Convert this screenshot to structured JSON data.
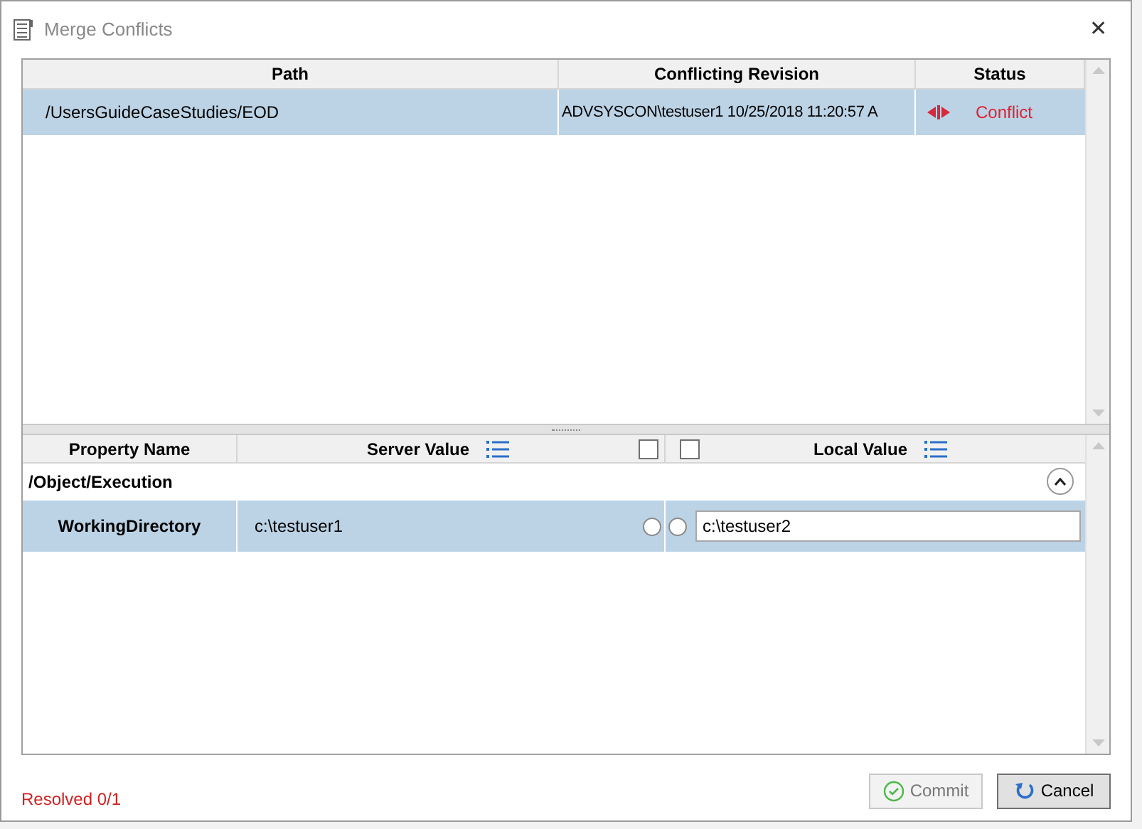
{
  "window": {
    "title": "Merge Conflicts",
    "close": "✕"
  },
  "conflicts": {
    "columns": [
      "Path",
      "Conflicting Revision",
      "Status"
    ],
    "rows": [
      {
        "path": "/UsersGuideCaseStudies/EOD",
        "revision": "ADVSYSCON\\testuser1 10/25/2018 11:20:57 A",
        "status": "Conflict",
        "selected": true
      }
    ]
  },
  "properties": {
    "columns": [
      "Property Name",
      "Server Value",
      "Local Value"
    ],
    "server_all_checked": false,
    "local_all_checked": false,
    "groups": [
      {
        "name": "/Object/Execution",
        "expanded": true,
        "rows": [
          {
            "name": "WorkingDirectory",
            "server_value": "c:\\testuser1",
            "local_value": "c:\\testuser2",
            "server_chosen": false,
            "local_chosen": false,
            "selected": true
          }
        ]
      }
    ]
  },
  "footer": {
    "resolved": "Resolved 0/1",
    "commit": {
      "label": "Commit",
      "disabled": true
    },
    "cancel": {
      "label": "Cancel"
    }
  }
}
